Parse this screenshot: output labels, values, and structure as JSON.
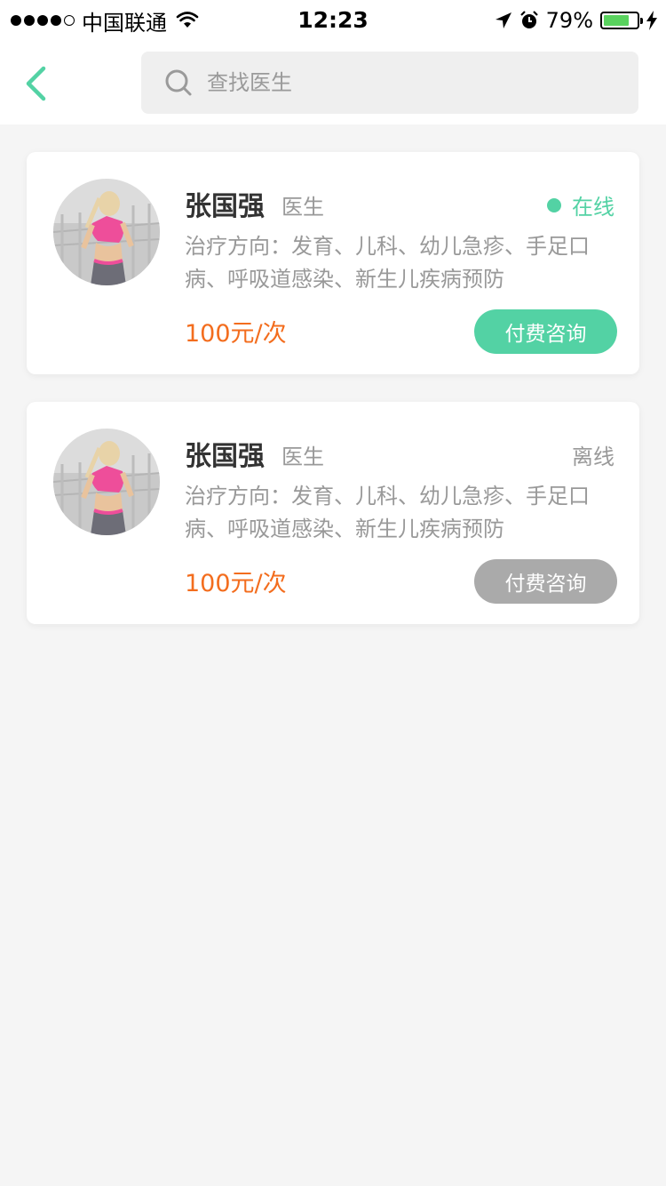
{
  "status_bar": {
    "carrier": "中国联通",
    "time": "12:23",
    "battery": "79%",
    "battery_level": 0.79,
    "signal_bars_filled": 4,
    "signal_bars_total": 5
  },
  "nav": {
    "back_icon": "chevron-left-icon",
    "search_icon": "search-icon",
    "search_placeholder": "查找医生",
    "search_value": ""
  },
  "colors": {
    "accent": "#53d2a4",
    "offline": "#aaaaaa",
    "price": "#f36d1e"
  },
  "doctors": [
    {
      "name": "张国强",
      "title": "医生",
      "status": "在线",
      "online": true,
      "specialty": "治疗方向：发育、儿科、幼儿急疹、手足口病、呼吸道感染、新生儿疾病预防",
      "price": "100元/次",
      "button": "付费咨询"
    },
    {
      "name": "张国强",
      "title": "医生",
      "status": "离线",
      "online": false,
      "specialty": "治疗方向：发育、儿科、幼儿急疹、手足口病、呼吸道感染、新生儿疾病预防",
      "price": "100元/次",
      "button": "付费咨询"
    }
  ]
}
